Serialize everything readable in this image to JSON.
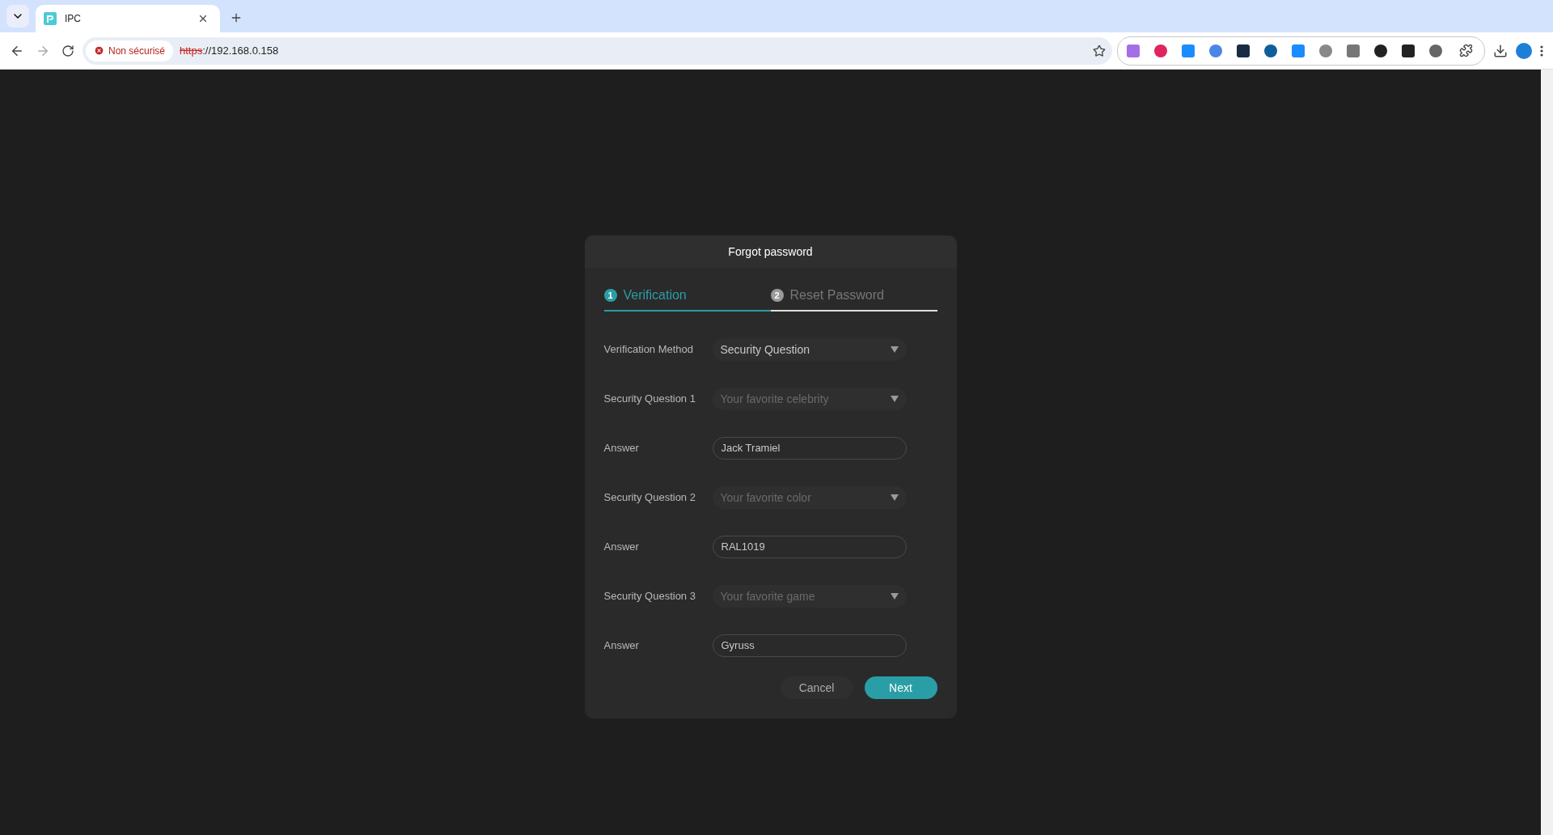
{
  "browser": {
    "tab": {
      "title": "IPC"
    },
    "security_chip": "Non sécurisé",
    "url_scheme": "https",
    "url_rest": "://192.168.0.158"
  },
  "dialog": {
    "title": "Forgot password",
    "steps": [
      {
        "number": "1",
        "label": "Verification",
        "selected": true
      },
      {
        "number": "2",
        "label": "Reset Password",
        "selected": false
      }
    ],
    "fields": [
      {
        "kind": "select",
        "label": "Verification Method",
        "value": "Security Question",
        "disabled": false
      },
      {
        "kind": "select",
        "label": "Security Question 1",
        "value": "Your favorite celebrity",
        "disabled": true
      },
      {
        "kind": "input",
        "label": "Answer",
        "value": "Jack Tramiel"
      },
      {
        "kind": "select",
        "label": "Security Question 2",
        "value": "Your favorite color",
        "disabled": true
      },
      {
        "kind": "input",
        "label": "Answer",
        "value": "RAL1019"
      },
      {
        "kind": "select",
        "label": "Security Question 3",
        "value": "Your favorite game",
        "disabled": true
      },
      {
        "kind": "input",
        "label": "Answer",
        "value": "Gyruss"
      }
    ],
    "buttons": [
      {
        "kind": "secondary",
        "label": "Cancel"
      },
      {
        "kind": "primary",
        "label": "Next"
      }
    ]
  }
}
